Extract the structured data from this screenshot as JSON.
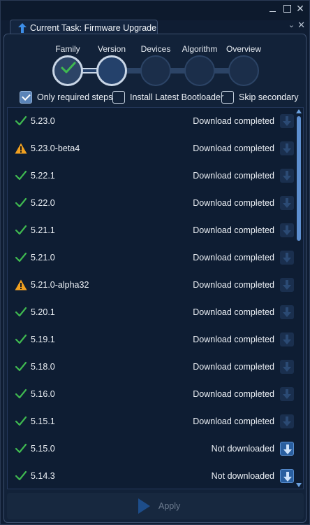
{
  "window": {
    "tab_title": "Current Task: Firmware Upgrade"
  },
  "wizard": {
    "steps": [
      "Family",
      "Version",
      "Devices",
      "Algorithm",
      "Overview"
    ],
    "completed_step": "Family",
    "current_step": "Version"
  },
  "options": {
    "only_required": {
      "label": "Only required steps",
      "checked": true
    },
    "install_bootloader": {
      "label": "Install Latest Bootloader",
      "checked": false
    },
    "skip_secondary": {
      "label": "Skip secondary",
      "checked": false
    }
  },
  "versions": [
    {
      "version": "5.23.0",
      "icon": "check-icon",
      "status": "Download completed"
    },
    {
      "version": "5.23.0-beta4",
      "icon": "warning-icon",
      "status": "Download completed"
    },
    {
      "version": "5.22.1",
      "icon": "check-icon",
      "status": "Download completed"
    },
    {
      "version": "5.22.0",
      "icon": "check-icon",
      "status": "Download completed"
    },
    {
      "version": "5.21.1",
      "icon": "check-icon",
      "status": "Download completed"
    },
    {
      "version": "5.21.0",
      "icon": "check-icon",
      "status": "Download completed"
    },
    {
      "version": "5.21.0-alpha32",
      "icon": "warning-icon",
      "status": "Download completed"
    },
    {
      "version": "5.20.1",
      "icon": "check-icon",
      "status": "Download completed"
    },
    {
      "version": "5.19.1",
      "icon": "check-icon",
      "status": "Download completed"
    },
    {
      "version": "5.18.0",
      "icon": "check-icon",
      "status": "Download completed"
    },
    {
      "version": "5.16.0",
      "icon": "check-icon",
      "status": "Download completed"
    },
    {
      "version": "5.15.1",
      "icon": "check-icon",
      "status": "Download completed"
    },
    {
      "version": "5.15.0",
      "icon": "check-icon",
      "status": "Not downloaded"
    },
    {
      "version": "5.14.3",
      "icon": "check-icon",
      "status": "Not downloaded"
    }
  ],
  "apply": {
    "label": "Apply"
  },
  "colors": {
    "check": "#3fb950",
    "warning": "#f0a020",
    "accent": "#5d8fd0",
    "background": "#0f1d33"
  }
}
